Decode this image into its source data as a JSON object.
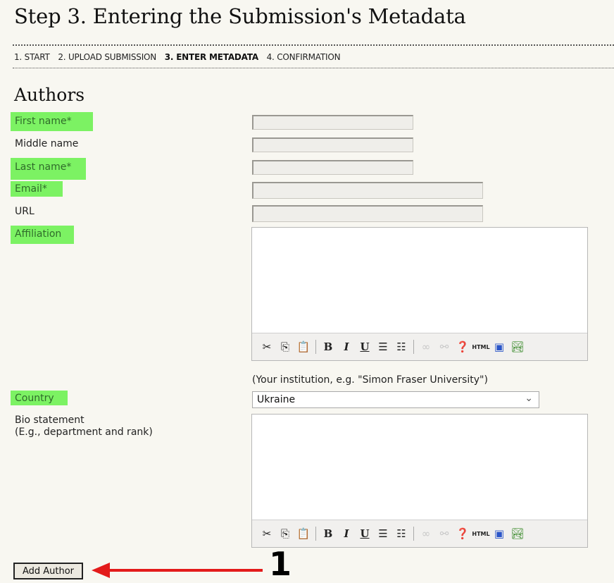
{
  "page": {
    "title": "Step 3. Entering the Submission's Metadata",
    "section": "Authors"
  },
  "steps": [
    {
      "label": "1. START",
      "current": false
    },
    {
      "label": "2. UPLOAD SUBMISSION",
      "current": false
    },
    {
      "label": "3. ENTER METADATA",
      "current": true
    },
    {
      "label": "4. CONFIRMATION",
      "current": false
    }
  ],
  "form": {
    "first_name_label": "First name*",
    "middle_name_label": "Middle name",
    "last_name_label": "Last name*",
    "email_label": "Email*",
    "url_label": "URL",
    "affiliation_label": "Affiliation",
    "affiliation_hint": "(Your institution, e.g. \"Simon Fraser University\")",
    "country_label": "Country",
    "country_value": "Ukraine",
    "bio_label_line1": "Bio statement",
    "bio_label_line2": "(E.g., department and rank)"
  },
  "toolbar_icons": [
    "cut-icon",
    "copy-icon",
    "paste-icon",
    "bold-icon",
    "italic-icon",
    "underline-icon",
    "bullet-list-icon",
    "numbered-list-icon",
    "link-icon",
    "unlink-icon",
    "help-icon",
    "html-icon",
    "fullscreen-icon",
    "image-icon"
  ],
  "actions": {
    "add_author": "Add Author"
  },
  "annotation": {
    "number": "1",
    "arrow_color": "#e31b1b"
  },
  "highlight_color": "#7cf263"
}
